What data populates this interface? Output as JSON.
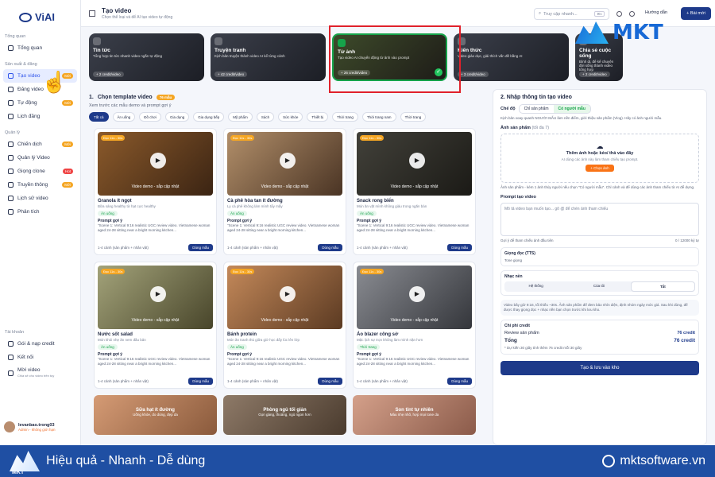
{
  "app": {
    "logo": "ViAI"
  },
  "sidebar": {
    "sections": [
      {
        "title": "Tổng quan",
        "items": [
          {
            "label": "Tổng quan"
          }
        ]
      },
      {
        "title": "Sản xuất & đăng",
        "items": [
          {
            "label": "Tạo video",
            "badge": "Mới"
          },
          {
            "label": "Đăng video"
          },
          {
            "label": "Tự động",
            "badge": "Mới"
          },
          {
            "label": "Lịch đăng"
          }
        ]
      },
      {
        "title": "Quản lý",
        "items": [
          {
            "label": "Chiến dịch",
            "badge": "Mới"
          },
          {
            "label": "Quản lý Video"
          },
          {
            "label": "Giọng clone",
            "badge": "Hot"
          },
          {
            "label": "Truyền thông",
            "badge": "Mới"
          },
          {
            "label": "Lịch sử video"
          },
          {
            "label": "Phân tích"
          }
        ]
      },
      {
        "title": "Tài khoản",
        "items": [
          {
            "label": "Gói & nạp credit"
          },
          {
            "label": "Kết nối"
          },
          {
            "label": "Mời video",
            "sub": "Chia sẻ cho video trên tuy"
          }
        ]
      }
    ],
    "user": {
      "name": "levanbao.trong03",
      "role": "Admin - không giới hạn"
    }
  },
  "header": {
    "title": "Tạo video",
    "subtitle": "Chọn thể loại và để AI tạo video tự động",
    "search": "Truy cập nhanh...",
    "shortcut": "⌘K",
    "guide": "Hướng dẫn",
    "new_btn": "+ Bài mới"
  },
  "modes": [
    {
      "title": "Tin tức",
      "desc": "Tổng hợp tin tức nhanh video ngắn tự động",
      "credit": "+ 2 credit/video"
    },
    {
      "title": "Truyện tranh",
      "desc": "Kịch bản truyện thành video AI kể từng cảnh",
      "credit": "+ 42 credit/video"
    },
    {
      "title": "Từ ảnh",
      "desc": "Tạo video AI chuyển động từ ảnh vào prompt",
      "credit": "+ 26 credit/video"
    },
    {
      "title": "Kiến thức",
      "desc": "Video giáo dục, giải thích vấn đề bằng AI",
      "credit": "+ 3 credit/video"
    },
    {
      "title": "Chia sẻ cuộc sống",
      "desc": "Bình dị, để kể chuyện đời sống thành video tổng hợp",
      "credit": "+ 2 credit/video"
    }
  ],
  "brand": {
    "mkt": "MKT",
    "tagline": "Hiệu quả - Nhanh - Dễ dùng",
    "website": "mktsoftware.vn"
  },
  "templates": {
    "step": "1.",
    "title": "Chọn template video",
    "badge": "76 mẫu",
    "subtitle": "Xem trước các mẫu demo và prompt gợi ý",
    "filters": [
      "Tất cả",
      "Ăn uống",
      "Đồ chơi",
      "Gia dụng",
      "Gia dụng bếp",
      "Mỹ phẩm",
      "Sách",
      "Sức khỏe",
      "Thiết bị",
      "Thời trang",
      "Thời trang nam",
      "Thời trang"
    ],
    "items": [
      {
        "name": "Granola ít ngọt",
        "desc": "Bữa sáng healthy từ hạt cực healthy",
        "tag": "Ăn uống",
        "dur": "Đọc 11s - 30s"
      },
      {
        "name": "Cà phê hòa tan ít đường",
        "desc": "Ly cà phê không làm mình tẩy mấy",
        "tag": "Ăn uống",
        "dur": "Đọc 11s - 30s"
      },
      {
        "name": "Snack rong biển",
        "desc": "Món ăn vặt mình không giảu trong ngăn bàn",
        "tag": "Ăn uống",
        "dur": "Đọc 11s - 30s"
      },
      {
        "name": "Nước sốt salad",
        "desc": "Món khỏi nhẹ ăn nem đầu bản",
        "tag": "Ăn uống",
        "dur": "Đọc 11s - 30s"
      },
      {
        "name": "Bánh protein",
        "desc": "Món ăn tranh thủ giữa giờ học đẩy lúc lên lớp",
        "tag": "Ăn uống",
        "dur": "Đọc 11s - 30s"
      },
      {
        "name": "Áo blazer công sở",
        "desc": "Mặc lịch sự trọn không làm mình nặn hơn",
        "tag": "Thời trang",
        "dur": "Đọc 11s - 30s"
      }
    ],
    "prompt_label": "Prompt gợi ý",
    "prompt_text": "\"Scene 1: Vertical 9:16 realistic UGC review video. Vietnamese woman aged 24-28 sitting near a bright morning kitchen...",
    "footer": "1-4 cảnh (sản phẩm + nhân vật)",
    "use": "Dùng mẫu",
    "video_demo": "Video demo - sắp cập nhật",
    "bottom": [
      {
        "a": "Sữa hạt ít đường",
        "b": "Uống khỏe, do dùng, đẹp da"
      },
      {
        "a": "Phòng ngủ tối giản",
        "b": "Gọn gàng, thoáng, ngủ ngon hơn"
      },
      {
        "a": "Son tint tự nhiên",
        "b": "Màu nhẹ nhõ, hợp mọi tone da"
      }
    ]
  },
  "form": {
    "step": "2.",
    "title": "Nhập thông tin tạo video",
    "mode_label": "Chế độ",
    "mode_opts": [
      "Chỉ sản phẩm",
      "Có người mẫu"
    ],
    "mode_note": "Kịch bản xoay quanh NGƯỜI MẪU làm nền điểm, giới thiệu sản phẩm (Vlog). Hãy có ảnh người mẫu.",
    "img_label": "Ảnh sản phẩm",
    "img_count": "(tối đa 7)",
    "upload_h": "Thêm ảnh hoặc kéo/ thả vào đây",
    "upload_s": "AI dùng các ảnh này làm tham chiếu tạo prompt.",
    "upload_btn": "+ Chọn ảnh",
    "note2": "Ảnh sản phẩm - kèm 1 ảnh thủy người nếu chọn \"Có người mẫu\". Chỉ cảnh và để dùng các ảnh tham chiếu từ AI để dựng.",
    "prompt_label": "Prompt tạo video",
    "prompt_ph": "Mô tả video bạn muốn tạo... gõ @ để chèn ảnh tham chiếu",
    "counter": "0 / 12000 ký tự",
    "hint": "Gợi ý để tham chiếu ảnh đầu tiên",
    "tts_label": "Giọng đọc (TTS)",
    "tts_val": "Tone giọng",
    "music_label": "Nhạc nền",
    "music_opts": [
      "Hệ thống",
      "Của tôi",
      "Tắt"
    ],
    "info": "Video bây giờ 9:16, tối thiểu ~30s. Ảnh sản phẩm để đem bảo nhìn diện, định nhóm ngày mức giá. Sau khi dùng, để được thay giọng đọc + nhạc nền bạn chọn trước khi lưu kho.",
    "cost_label": "Chi phí credit",
    "cost_rows": [
      {
        "k": "Review sản phẩm",
        "v": "76 credit"
      },
      {
        "k": "Tổng",
        "v": "76 credit"
      }
    ],
    "cost_note": "* Dự kiến 30 giây tính thêm 76 credit mỗi 30 giây",
    "create": "Tạo & lưu vào kho"
  }
}
